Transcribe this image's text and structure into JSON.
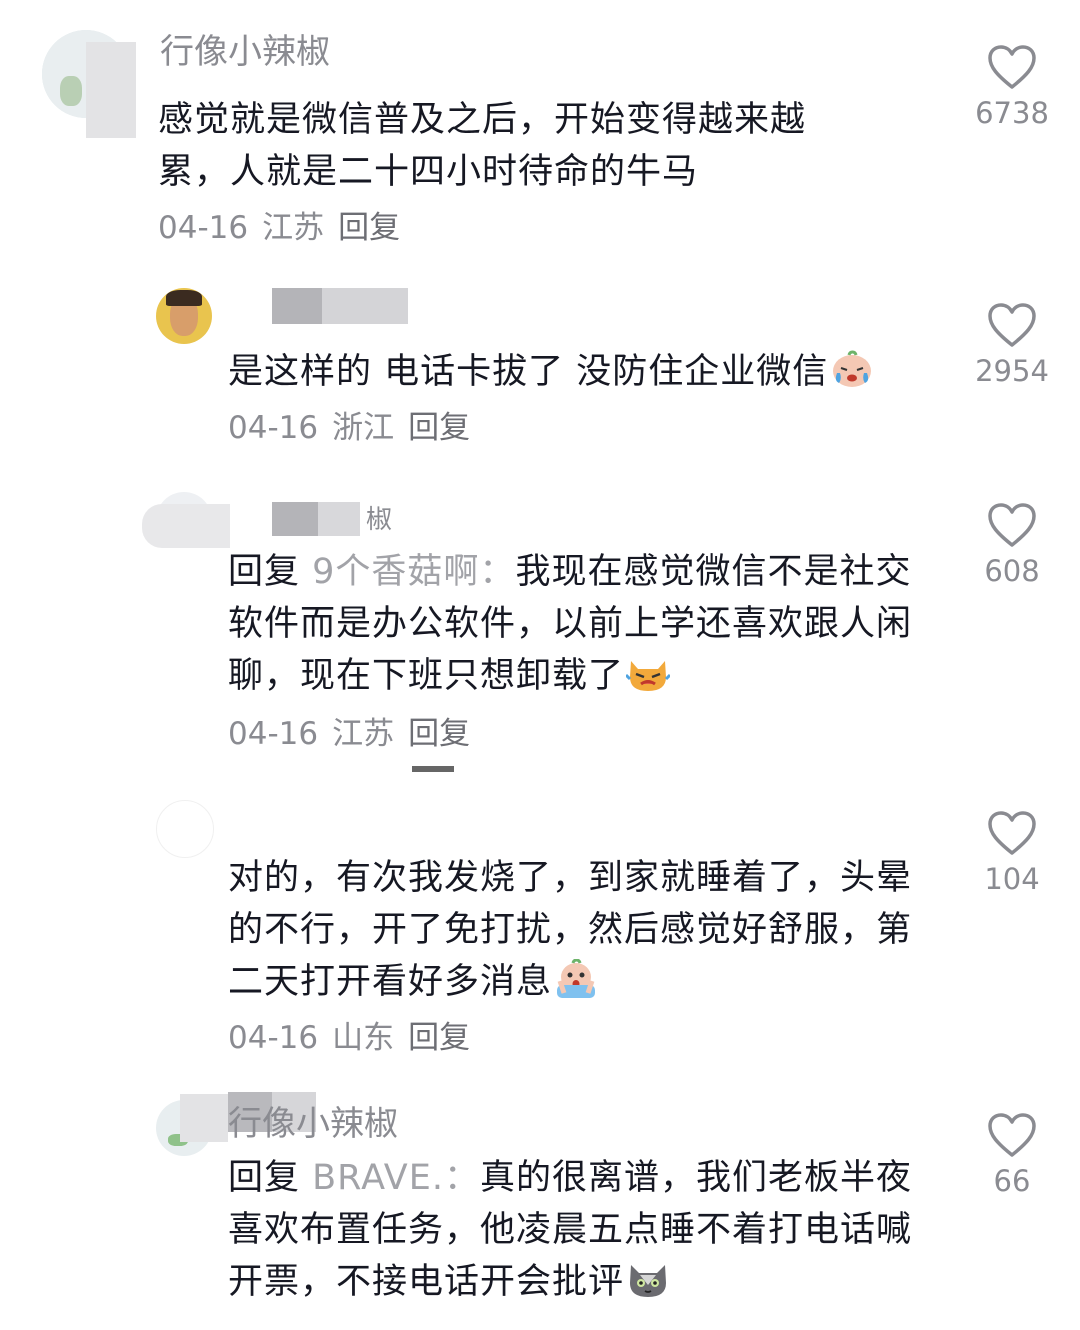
{
  "comments": [
    {
      "username": "行像小辣椒",
      "text": "感觉就是微信普及之后，开始变得越来越累，人就是二十四小时待命的牛马",
      "date": "04-16",
      "location": "江苏",
      "reply_label": "回复",
      "likes": "6738"
    },
    {
      "username": "",
      "text": "是这样的 电话卡拔了 没防住企业微信",
      "emoji": "crying-face-emoji",
      "date": "04-16",
      "location": "浙江",
      "reply_label": "回复",
      "likes": "2954"
    },
    {
      "username": "椒",
      "reply_prefix": "回复",
      "reply_target": "9个香菇啊：",
      "text": "我现在感觉微信不是社交软件而是办公软件，以前上学还喜欢跟人闲聊，现在下班只想卸载了",
      "emoji": "angry-cat-emoji",
      "date": "04-16",
      "location": "江苏",
      "reply_label": "回复",
      "likes": "608"
    },
    {
      "username": "",
      "text": "对的，有次我发烧了，到家就睡着了，头晕的不行，开了免打扰，然后感觉好舒服，第二天打开看好多消息",
      "emoji": "screaming-face-emoji",
      "date": "04-16",
      "location": "山东",
      "reply_label": "回复",
      "likes": "104"
    },
    {
      "username": "行像小辣椒",
      "reply_prefix": "回复",
      "reply_target": "BRAVE.：",
      "text": "真的很离谱，我们老板半夜喜欢布置任务，他凌晨五点睡不着打电话喊开票，不接电话开会批评",
      "emoji": "gray-cat-emoji",
      "likes": "66"
    }
  ],
  "icons": {
    "like": "heart-outline-icon"
  },
  "colors": {
    "text": "#161823",
    "secondary": "#8a8b91",
    "reply_target": "#a2a3a8"
  }
}
